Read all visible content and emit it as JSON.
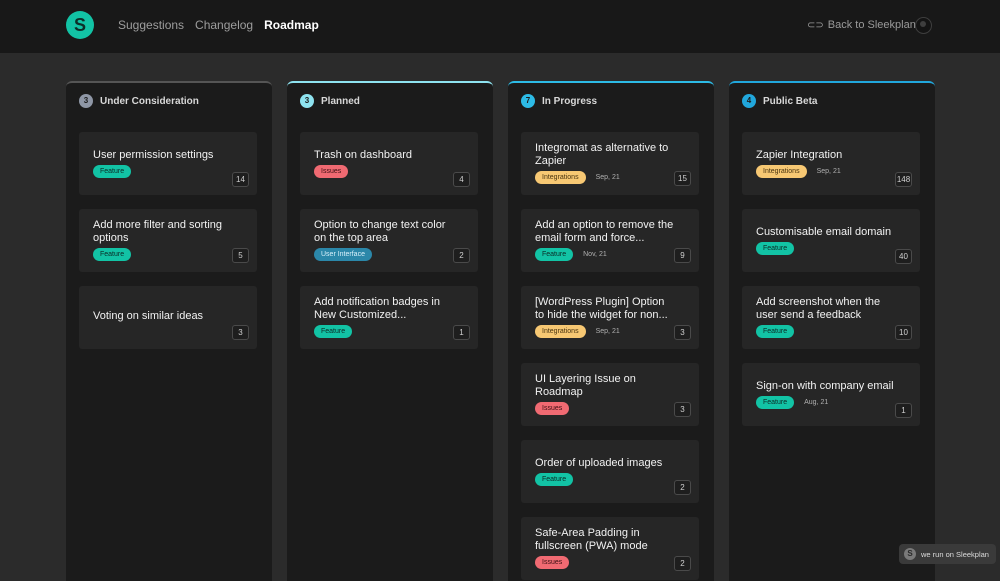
{
  "logo_letter": "S",
  "nav": [
    {
      "label": "Suggestions"
    },
    {
      "label": "Changelog"
    },
    {
      "label": "Roadmap"
    }
  ],
  "back_link": "Back to Sleekplan",
  "colors": {
    "accent": "#12c3a5",
    "feature": "#12c3a5",
    "issues": "#f06a72",
    "integrations": "#f7c873",
    "user_interface": "#2b87a9"
  },
  "columns": [
    {
      "count": "3",
      "title": "Under Consideration",
      "color": "#8f97a6",
      "cards": [
        {
          "title": "User permission settings",
          "tag": "Feature",
          "date": "",
          "votes": "14"
        },
        {
          "title": "Add more filter and sorting options",
          "tag": "Feature",
          "date": "",
          "votes": "5"
        },
        {
          "title": "Voting on similar ideas",
          "tag": "",
          "date": "",
          "votes": "3"
        }
      ]
    },
    {
      "count": "3",
      "title": "Planned",
      "color": "#8ee3f0",
      "cards": [
        {
          "title": "Trash on dashboard",
          "tag": "Issues",
          "date": "",
          "votes": "4"
        },
        {
          "title": "Option to change text color on the top area",
          "tag": "User Interface",
          "date": "",
          "votes": "2"
        },
        {
          "title": "Add notification badges in New Customized...",
          "tag": "Feature",
          "date": "",
          "votes": "1"
        }
      ]
    },
    {
      "count": "7",
      "title": "In Progress",
      "color": "#2dbbe6",
      "cards": [
        {
          "title": "Integromat as alternative to Zapier",
          "tag": "Integrations",
          "date": "Sep, 21",
          "votes": "15"
        },
        {
          "title": "Add an option to remove the email form and force...",
          "tag": "Feature",
          "date": "Nov, 21",
          "votes": "9"
        },
        {
          "title": "[WordPress Plugin] Option to hide the widget for non...",
          "tag": "Integrations",
          "date": "Sep, 21",
          "votes": "3"
        },
        {
          "title": "UI Layering Issue on Roadmap",
          "tag": "Issues",
          "date": "",
          "votes": "3"
        },
        {
          "title": "Order of uploaded images",
          "tag": "Feature",
          "date": "",
          "votes": "2"
        },
        {
          "title": "Safe-Area Padding in fullscreen (PWA) mode",
          "tag": "Issues",
          "date": "",
          "votes": "2"
        }
      ]
    },
    {
      "count": "4",
      "title": "Public Beta",
      "color": "#21a7dc",
      "cards": [
        {
          "title": "Zapier Integration",
          "tag": "Integrations",
          "date": "Sep, 21",
          "votes": "148"
        },
        {
          "title": "Customisable email domain",
          "tag": "Feature",
          "date": "",
          "votes": "40"
        },
        {
          "title": "Add screenshot when the user send a feedback",
          "tag": "Feature",
          "date": "",
          "votes": "10"
        },
        {
          "title": "Sign-on with company email",
          "tag": "Feature",
          "date": "Aug, 21",
          "votes": "1"
        }
      ]
    }
  ],
  "footer_badge": "we run on Sleekplan"
}
